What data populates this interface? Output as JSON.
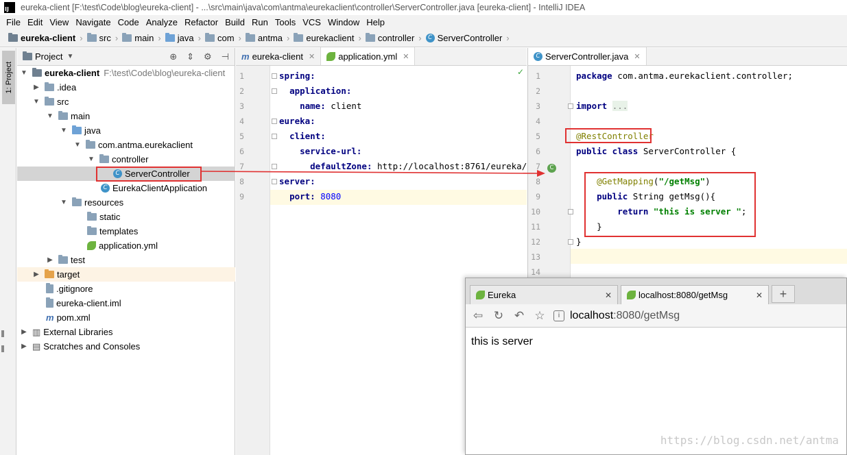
{
  "window": {
    "title": "eureka-client [F:\\test\\Code\\blog\\eureka-client] - ...\\src\\main\\java\\com\\antma\\eurekaclient\\controller\\ServerController.java [eureka-client] - IntelliJ IDEA",
    "logo": "IJ"
  },
  "menu": [
    "File",
    "Edit",
    "View",
    "Navigate",
    "Code",
    "Analyze",
    "Refactor",
    "Build",
    "Run",
    "Tools",
    "VCS",
    "Window",
    "Help"
  ],
  "breadcrumbs": [
    "eureka-client",
    "src",
    "main",
    "java",
    "com",
    "antma",
    "eurekaclient",
    "controller",
    "ServerController"
  ],
  "sidebar": {
    "tab_label": "1: Project"
  },
  "project": {
    "header": "Project",
    "root": {
      "name": "eureka-client",
      "path": "F:\\test\\Code\\blog\\eureka-client"
    },
    "items": [
      ".idea",
      "src",
      "main",
      "java",
      "com.antma.eurekaclient",
      "controller",
      "ServerController",
      "EurekaClientApplication",
      "resources",
      "static",
      "templates",
      "application.yml",
      "test",
      "target",
      ".gitignore",
      "eureka-client.iml",
      "pom.xml",
      "External Libraries",
      "Scratches and Consoles"
    ]
  },
  "yml_editor": {
    "tabs": [
      "eureka-client",
      "application.yml"
    ],
    "line_numbers": [
      "1",
      "2",
      "3",
      "4",
      "5",
      "6",
      "7",
      "8",
      "9"
    ]
  },
  "java_editor": {
    "tab": "ServerController.java",
    "line_numbers": [
      "1",
      "2",
      "3",
      "4",
      "5",
      "6",
      "7",
      "8",
      "9",
      "10",
      "11",
      "12",
      "13",
      "14"
    ]
  },
  "browser": {
    "tabs": [
      "Eureka",
      "localhost:8080/getMsg"
    ],
    "url_host": "localhost",
    "url_rest": ":8080/getMsg",
    "content": "this is server"
  },
  "watermark": "https://blog.csdn.net/antma"
}
